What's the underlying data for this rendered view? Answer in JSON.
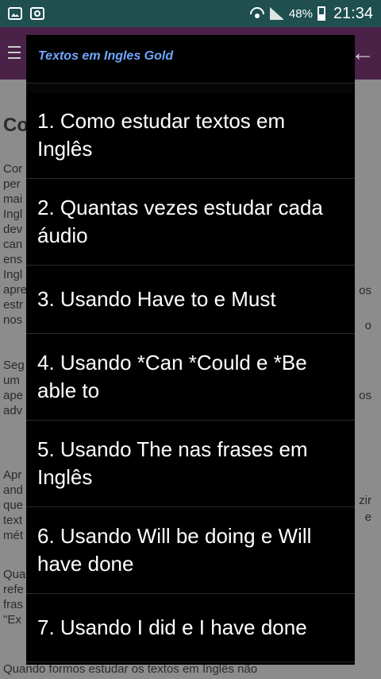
{
  "status_bar": {
    "battery": "48%",
    "time": "21:34"
  },
  "background": {
    "title_fragment": "Co",
    "left_fragments": [
      "Cor",
      "per",
      "mai",
      "Ingl",
      "dev",
      "can",
      "ens",
      "Ingl",
      "apre",
      "estr",
      "nos",
      "",
      "Seg",
      "um",
      "ape",
      "adv",
      "",
      "",
      "Apr",
      "and",
      "que",
      "text",
      "mét",
      "",
      "Qua",
      "refe",
      "fras",
      "\"Ex"
    ],
    "right_fragments": [
      "os",
      "o",
      "os",
      "zir",
      "e"
    ],
    "bottom_line": "Quando formos estudar os textos em Inglês não"
  },
  "dialog": {
    "title": "Textos em Ingles Gold",
    "items": [
      "1. Como estudar textos em Inglês",
      "2. Quantas vezes estudar cada áudio",
      "3. Usando Have to e Must",
      "4. Usando *Can *Could  e *Be able to",
      "5. Usando The nas frases em Inglês",
      "6. Usando Will be doing e Will have done",
      "7. Usando I did e I have done"
    ]
  }
}
